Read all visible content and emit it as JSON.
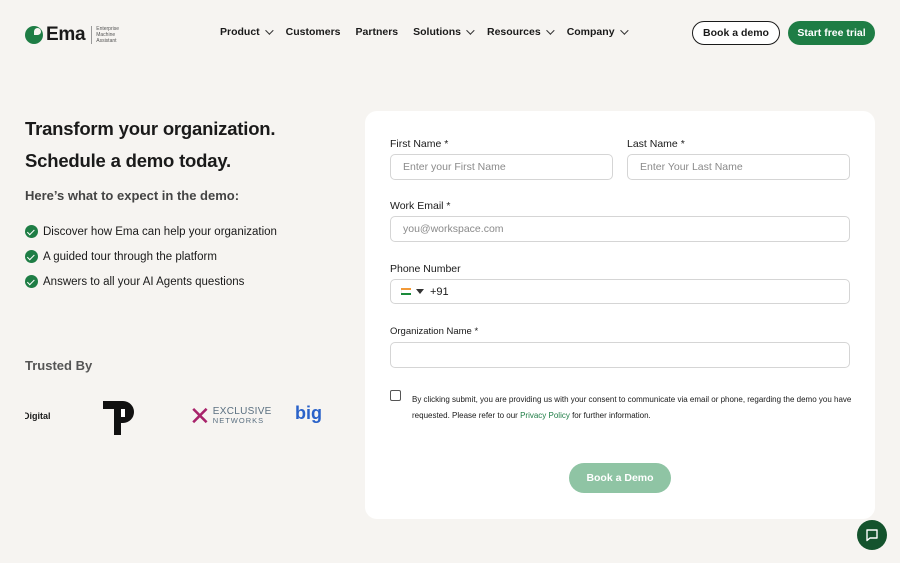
{
  "nav": {
    "logo_word": "Ema",
    "logo_tagline": [
      "Enterprise",
      "Machine",
      "Assistant"
    ],
    "menu": [
      {
        "label": "Product",
        "dropdown": true
      },
      {
        "label": "Customers",
        "dropdown": false
      },
      {
        "label": "Partners",
        "dropdown": false
      },
      {
        "label": "Solutions",
        "dropdown": true
      },
      {
        "label": "Resources",
        "dropdown": true
      },
      {
        "label": "Company",
        "dropdown": true
      }
    ],
    "book_demo": "Book a demo",
    "start_trial": "Start free trial"
  },
  "hero": {
    "line1": "Transform your organization.",
    "line2": "Schedule a demo today.",
    "expect": "Here’s what to expect in the demo:",
    "bullets": [
      "Discover how Ema can help your organization",
      "A guided tour through the platform",
      "Answers to all your AI Agents questions"
    ],
    "trusted_by": "Trusted By",
    "logos": {
      "digital": "Digital",
      "exclusive_top": "EXCLUSIVE",
      "exclusive_bottom": "NETWORKS",
      "big": "big"
    }
  },
  "form": {
    "first_name_label": "First Name *",
    "first_name_placeholder": "Enter your First Name",
    "last_name_label": "Last Name *",
    "last_name_placeholder": "Enter Your Last Name",
    "email_label": "Work Email *",
    "email_placeholder": "you@workspace.com",
    "phone_label": "Phone Number",
    "phone_code": "+91",
    "org_label": "Organization Name *",
    "consent_before": "By clicking submit, you are providing us with your consent to communicate via email or phone, regarding the demo you have requested. Please refer to our ",
    "consent_link": "Privacy Policy",
    "consent_after": " for further information.",
    "submit": "Book a Demo"
  },
  "colors": {
    "brand_green": "#1e7d45",
    "submit_disabled": "#8fc4a4",
    "page_bg": "#f6f4f1"
  }
}
